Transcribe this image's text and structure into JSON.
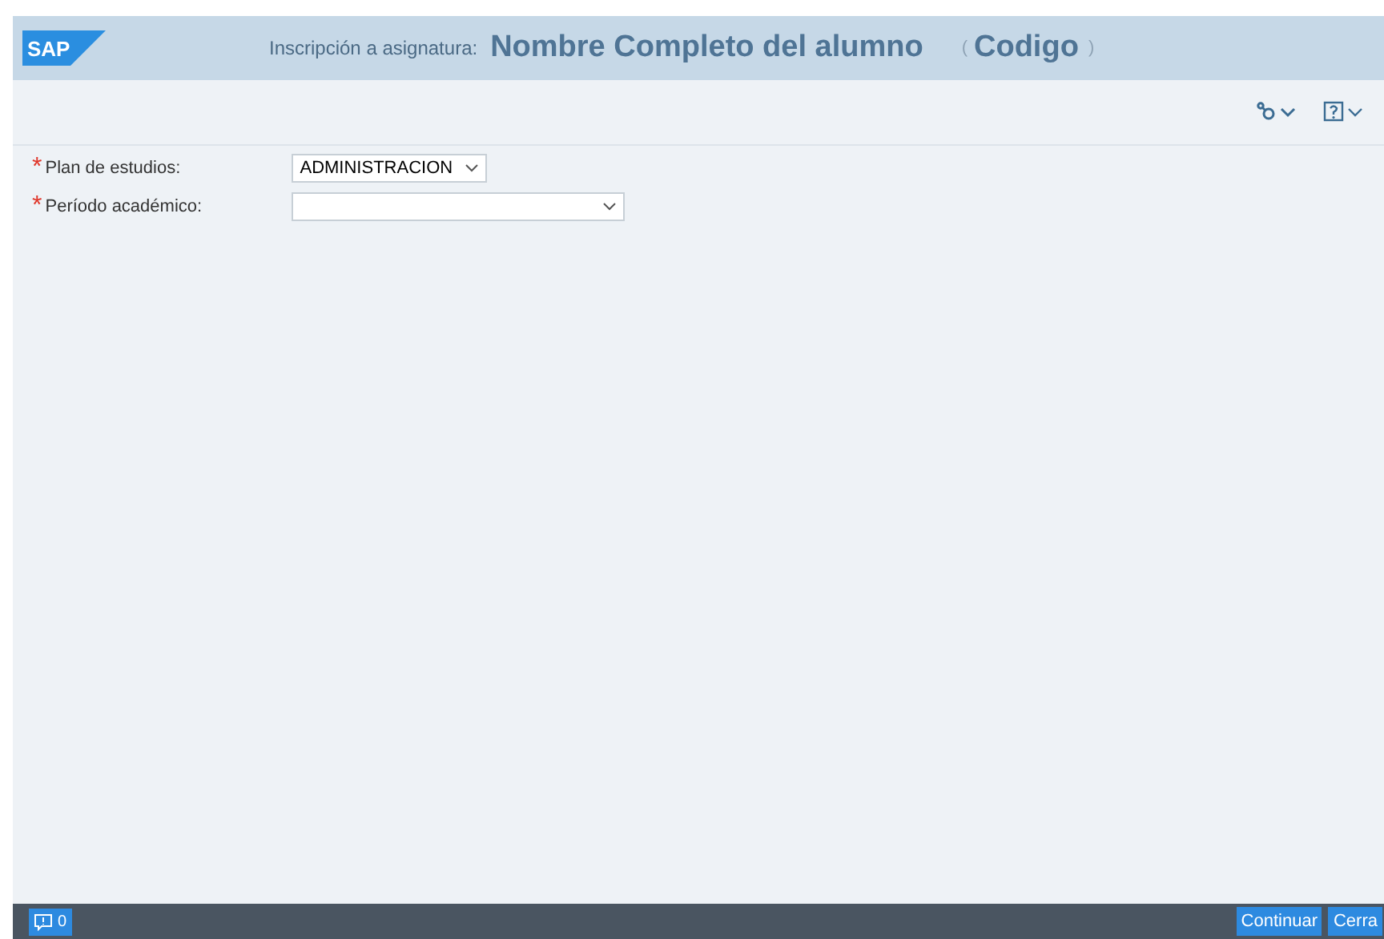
{
  "header": {
    "logo": "SAP",
    "label": "Inscripción a asignatura:",
    "student_name": "Nombre Completo del alumno",
    "open_paren": "(",
    "code": "Codigo",
    "close_paren": ")"
  },
  "fields": [
    {
      "label": "Plan de estudios:",
      "required_mark": "*",
      "value": "ADMINISTRACION",
      "kind": "short"
    },
    {
      "label": "Período académico:",
      "required_mark": "*",
      "kind": "long"
    }
  ],
  "footer": {
    "messages_count": "0",
    "buttons": [
      "Continuar",
      "Cerra"
    ]
  }
}
